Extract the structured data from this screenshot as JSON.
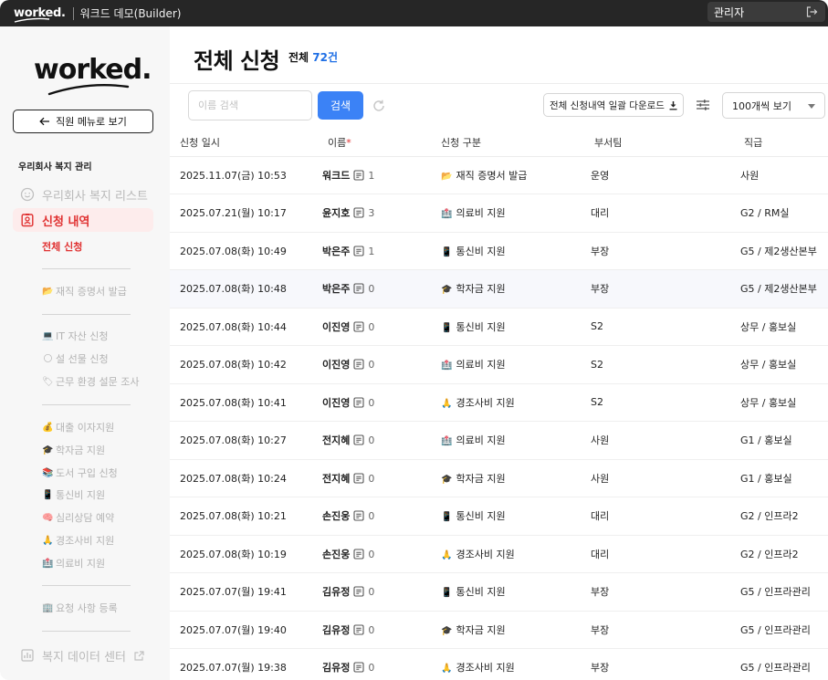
{
  "topbar": {
    "logo": "worked.",
    "title": "워크드 데모(Builder)",
    "admin_label": "관리자",
    "icons": [
      "logout-icon"
    ]
  },
  "sidebar": {
    "brand": "worked.",
    "employee_menu_button": "직원 메뉴로 보기",
    "section_title": "우리회사 복지 관리",
    "welfare_list": "우리회사 복지 리스트",
    "requests": "신청 내역",
    "sub": {
      "all": "전체 신청",
      "employment_cert": {
        "emoji": "📂",
        "label": "재직 증명서 발급"
      },
      "it_asset": {
        "emoji": "💻",
        "label": "IT 자산 신청"
      },
      "holiday_gift": {
        "emoji": "🌕",
        "label": "설 선물 신청"
      },
      "work_env": {
        "emoji": "🏷",
        "label": "근무 환경 설문 조사"
      },
      "loan": {
        "emoji": "💰",
        "label": "대출 이자지원"
      },
      "tuition": {
        "emoji": "🎓",
        "label": "학자금 지원"
      },
      "books": {
        "emoji": "📚",
        "label": "도서 구입 신청"
      },
      "phone": {
        "emoji": "📱",
        "label": "통신비 지원"
      },
      "counseling": {
        "emoji": "🧠",
        "label": "심리상담 예약"
      },
      "condolence": {
        "emoji": "🙏",
        "label": "경조사비 지원"
      },
      "medical": {
        "emoji": "🏥",
        "label": "의료비 지원"
      },
      "request_register": {
        "emoji": "🏢",
        "label": "요청 사항 등록"
      }
    },
    "data_center": "복지 데이터 센터"
  },
  "main": {
    "title": "전체 신청",
    "count_label": "전체",
    "count_value": "72건",
    "search": {
      "placeholder": "이름 검색",
      "button": "검색"
    },
    "download_button": "전체 신청내역 일괄 다운로드",
    "per_page": "100개씩 보기",
    "columns": [
      "신청 일시",
      "이름",
      "신청 구분",
      "부서팀",
      "직급"
    ],
    "required_mark": "*",
    "rows": [
      {
        "date": "2025.11.07(금) 10:53",
        "name": "워크드",
        "memo": "1",
        "emoji": "📂",
        "type": "재직 증명서 발급",
        "dept": "운영",
        "rank": "사원"
      },
      {
        "date": "2025.07.21(월) 10:17",
        "name": "윤지호",
        "memo": "3",
        "emoji": "🏥",
        "type": "의료비 지원",
        "dept": "대리",
        "rank": "G2 / RM실"
      },
      {
        "date": "2025.07.08(화) 10:49",
        "name": "박은주",
        "memo": "1",
        "emoji": "📱",
        "type": "통신비 지원",
        "dept": "부장",
        "rank": "G5 / 제2생산본부"
      },
      {
        "date": "2025.07.08(화) 10:48",
        "name": "박은주",
        "memo": "0",
        "emoji": "🎓",
        "type": "학자금 지원",
        "dept": "부장",
        "rank": "G5 / 제2생산본부"
      },
      {
        "date": "2025.07.08(화) 10:44",
        "name": "이진영",
        "memo": "0",
        "emoji": "📱",
        "type": "통신비 지원",
        "dept": "S2",
        "rank": "상무 / 홍보실"
      },
      {
        "date": "2025.07.08(화) 10:42",
        "name": "이진영",
        "memo": "0",
        "emoji": "🏥",
        "type": "의료비 지원",
        "dept": "S2",
        "rank": "상무 / 홍보실"
      },
      {
        "date": "2025.07.08(화) 10:41",
        "name": "이진영",
        "memo": "0",
        "emoji": "🙏",
        "type": "경조사비 지원",
        "dept": "S2",
        "rank": "상무 / 홍보실"
      },
      {
        "date": "2025.07.08(화) 10:27",
        "name": "전지혜",
        "memo": "0",
        "emoji": "🏥",
        "type": "의료비 지원",
        "dept": "사원",
        "rank": "G1 / 홍보실"
      },
      {
        "date": "2025.07.08(화) 10:24",
        "name": "전지혜",
        "memo": "0",
        "emoji": "🎓",
        "type": "학자금 지원",
        "dept": "사원",
        "rank": "G1 / 홍보실"
      },
      {
        "date": "2025.07.08(화) 10:21",
        "name": "손진웅",
        "memo": "0",
        "emoji": "📱",
        "type": "통신비 지원",
        "dept": "대리",
        "rank": "G2 / 인프라2"
      },
      {
        "date": "2025.07.08(화) 10:19",
        "name": "손진웅",
        "memo": "0",
        "emoji": "🙏",
        "type": "경조사비 지원",
        "dept": "대리",
        "rank": "G2 / 인프라2"
      },
      {
        "date": "2025.07.07(월) 19:41",
        "name": "김유정",
        "memo": "0",
        "emoji": "📱",
        "type": "통신비 지원",
        "dept": "부장",
        "rank": "G5 / 인프라관리"
      },
      {
        "date": "2025.07.07(월) 19:40",
        "name": "김유정",
        "memo": "0",
        "emoji": "🎓",
        "type": "학자금 지원",
        "dept": "부장",
        "rank": "G5 / 인프라관리"
      },
      {
        "date": "2025.07.07(월) 19:38",
        "name": "김유정",
        "memo": "0",
        "emoji": "🙏",
        "type": "경조사비 지원",
        "dept": "부장",
        "rank": "G5 / 인프라관리"
      }
    ]
  },
  "colors": {
    "accent": "#e03131",
    "primary": "#3b82f6",
    "count": "#1f6fe5",
    "topbar": "#262626",
    "sidebar": "#f7f7f7"
  }
}
